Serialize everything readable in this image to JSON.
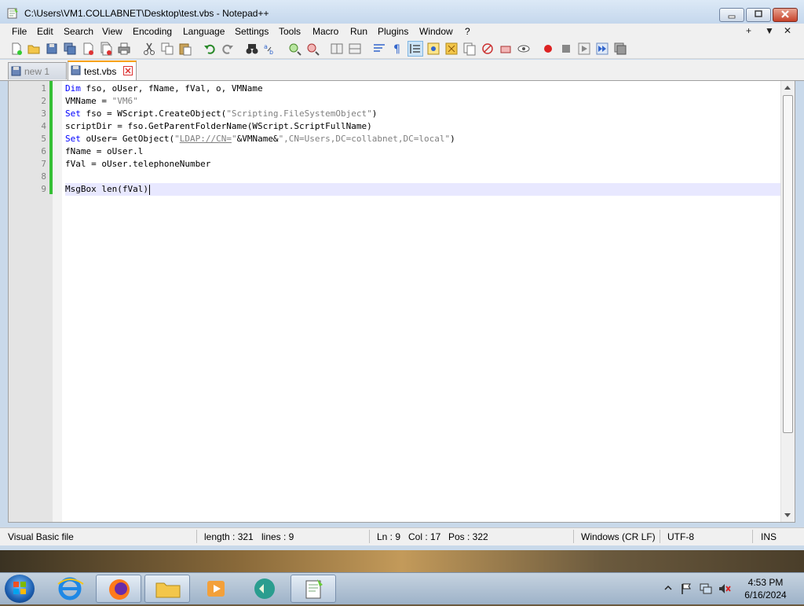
{
  "window": {
    "title": "C:\\Users\\VM1.COLLABNET\\Desktop\\test.vbs - Notepad++"
  },
  "menu": {
    "items": [
      "File",
      "Edit",
      "Search",
      "View",
      "Encoding",
      "Language",
      "Settings",
      "Tools",
      "Macro",
      "Run",
      "Plugins",
      "Window",
      "?"
    ],
    "right": {
      "plus": "+",
      "dropdown": "▼",
      "close": "✕"
    }
  },
  "tabs": [
    {
      "label": "new 1",
      "active": false
    },
    {
      "label": "test.vbs",
      "active": true
    }
  ],
  "editor": {
    "lines": [
      {
        "num": "1",
        "text": "Dim fso, oUser, fName, fVal, o, VMName"
      },
      {
        "num": "2",
        "text": "VMName = \"VM6\""
      },
      {
        "num": "3",
        "text": "Set fso = WScript.CreateObject(\"Scripting.FileSystemObject\")"
      },
      {
        "num": "4",
        "text": "scriptDir = fso.GetParentFolderName(WScript.ScriptFullName)"
      },
      {
        "num": "5",
        "text": "Set oUser= GetObject(\"LDAP://CN=\"&VMName&\",CN=Users,DC=collabnet,DC=local\")"
      },
      {
        "num": "6",
        "text": "fName = oUser.l"
      },
      {
        "num": "7",
        "text": "fVal = oUser.telephoneNumber"
      },
      {
        "num": "8",
        "text": ""
      },
      {
        "num": "9",
        "text": "MsgBox len(fVal)"
      }
    ],
    "current_line": 9
  },
  "status": {
    "file_type": "Visual Basic file",
    "length": "length : 321",
    "lines": "lines : 9",
    "ln": "Ln : 9",
    "col": "Col : 17",
    "pos": "Pos : 322",
    "eol": "Windows (CR LF)",
    "encoding": "UTF-8",
    "mode": "INS"
  },
  "taskbar": {
    "time": "4:53 PM",
    "date": "6/16/2024"
  },
  "colors": {
    "keyword": "#0000ff",
    "string": "#808080",
    "change_bar": "#36c036",
    "active_tab_accent": "#f7a21b"
  }
}
